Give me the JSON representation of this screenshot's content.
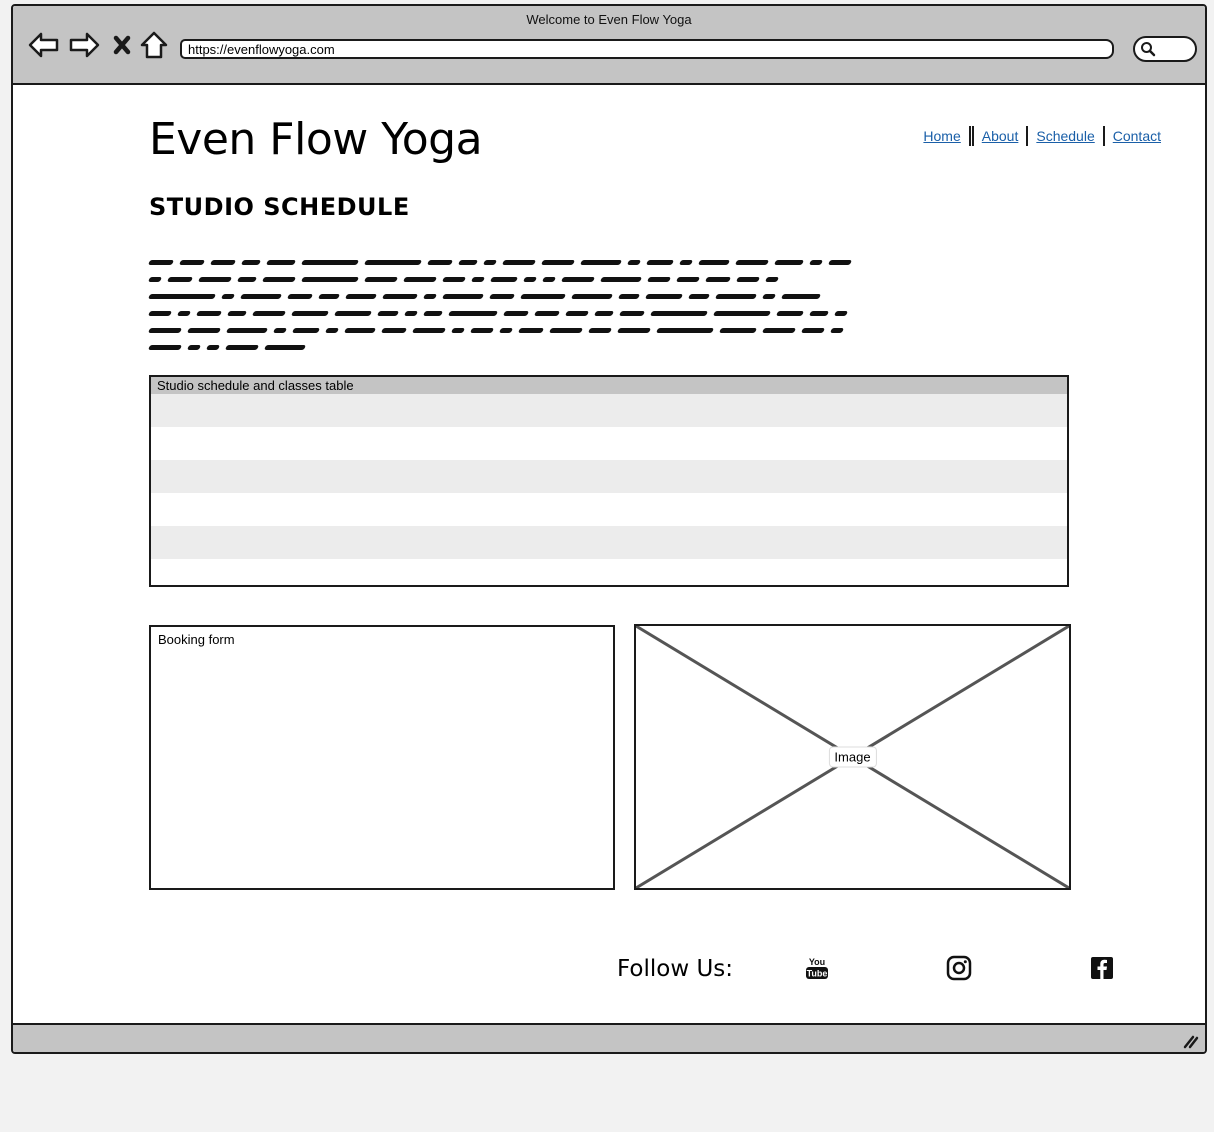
{
  "window": {
    "title": "Welcome to Even Flow Yoga",
    "url": "https://evenflowyoga.com"
  },
  "icons": {
    "back": "back-arrow-icon",
    "forward": "forward-arrow-icon",
    "stop": "close-icon",
    "home": "home-icon",
    "search": "search-icon",
    "youtube": "youtube-icon",
    "instagram": "instagram-icon",
    "facebook": "facebook-icon"
  },
  "site": {
    "title": "Even Flow Yoga",
    "nav": [
      "Home",
      "About",
      "Schedule",
      "Contact"
    ],
    "link_color": "#1a5fa8"
  },
  "main": {
    "section_title": "STUDIO SCHEDULE",
    "table_label": "Studio schedule and classes table",
    "form_label": "Booking form",
    "image_label": "Image"
  },
  "footer": {
    "follow_label": "Follow Us:"
  }
}
